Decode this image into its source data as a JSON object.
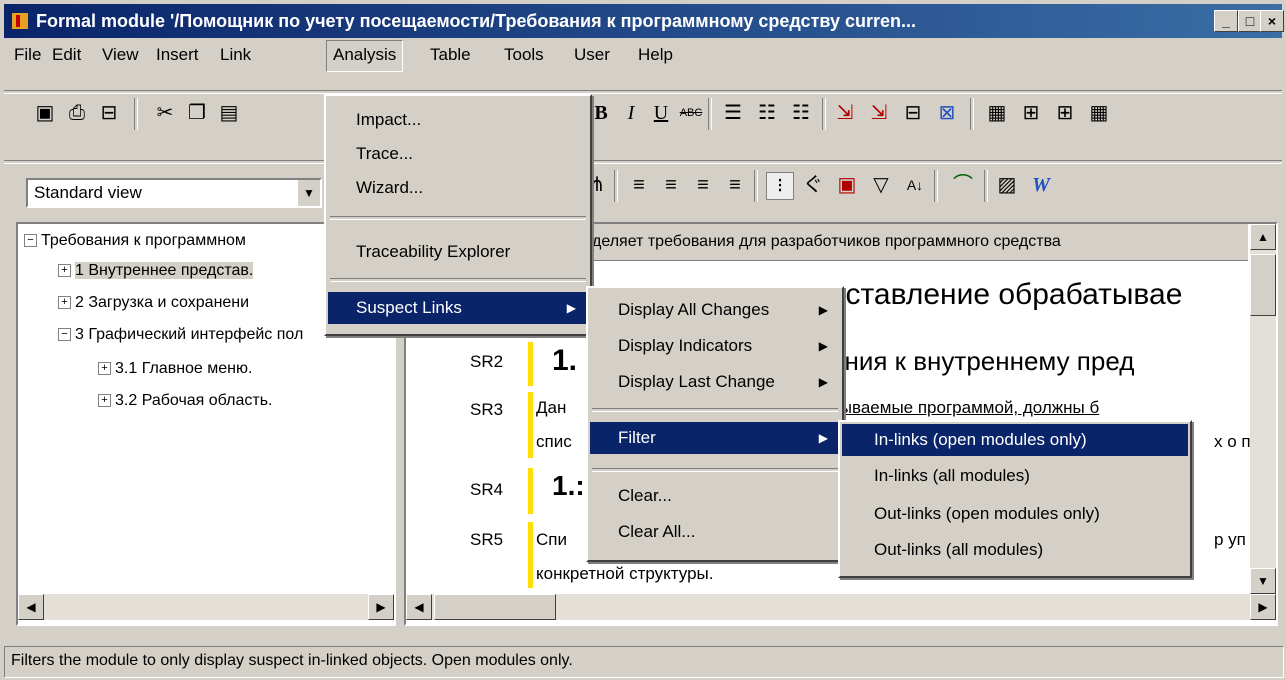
{
  "title": "Formal module '/Помощник по учету посещаемости/Требования к программному средству curren...",
  "window_buttons": [
    "_",
    "□",
    "×"
  ],
  "menu": [
    "File",
    "Edit",
    "View",
    "Insert",
    "Link",
    "Analysis",
    "Table",
    "Tools",
    "User",
    "Help"
  ],
  "view_combo": "Standard view",
  "tree": [
    {
      "label": "Требования к программном",
      "level": 0,
      "expander": "−"
    },
    {
      "label": "1 Внутреннее представ.",
      "level": 1,
      "expander": "+"
    },
    {
      "label": "2 Загрузка и сохранени",
      "level": 1,
      "expander": "+"
    },
    {
      "label": "3 Графический интерфейс пол",
      "level": 1,
      "expander": "−"
    },
    {
      "label": "3.1 Главное меню.",
      "level": 2,
      "expander": "+"
    },
    {
      "label": "3.2 Рабочая область.",
      "level": 2,
      "expander": "+"
    }
  ],
  "content": {
    "header": "деляет требования для разработчиков программного средства",
    "rows": [
      {
        "id": "SR2",
        "text": "1.",
        "overflow": "ания к внутреннему пред"
      },
      {
        "id": "SR3",
        "text": "Дан",
        "line2": "спис",
        "overflow": "тываемые программой, должны б",
        "overflow2": "х о п"
      },
      {
        "id": "SR4",
        "text": "1.:"
      },
      {
        "id": "SR5",
        "text": "Спи",
        "line2": "конкретной структуры.",
        "overflow": "р уп"
      }
    ],
    "heading_overflow": "дставление обрабатывае"
  },
  "analysis_menu": {
    "items": [
      "Impact...",
      "Trace...",
      "Wizard...",
      "Traceability Explorer",
      "Suspect Links"
    ]
  },
  "suspect_menu": {
    "items": [
      "Display All Changes",
      "Display Indicators",
      "Display Last Change",
      "Filter",
      "Clear...",
      "Clear All..."
    ]
  },
  "filter_menu": {
    "items": [
      "In-links (open modules only)",
      "In-links (all modules)",
      "Out-links (open modules only)",
      "Out-links (all modules)"
    ]
  },
  "status": "Filters the module to only display suspect in-linked objects. Open modules only.",
  "colors": {
    "titlebar": "#0a246a",
    "highlight": "#0a246a",
    "yellow": "#ffe000"
  }
}
